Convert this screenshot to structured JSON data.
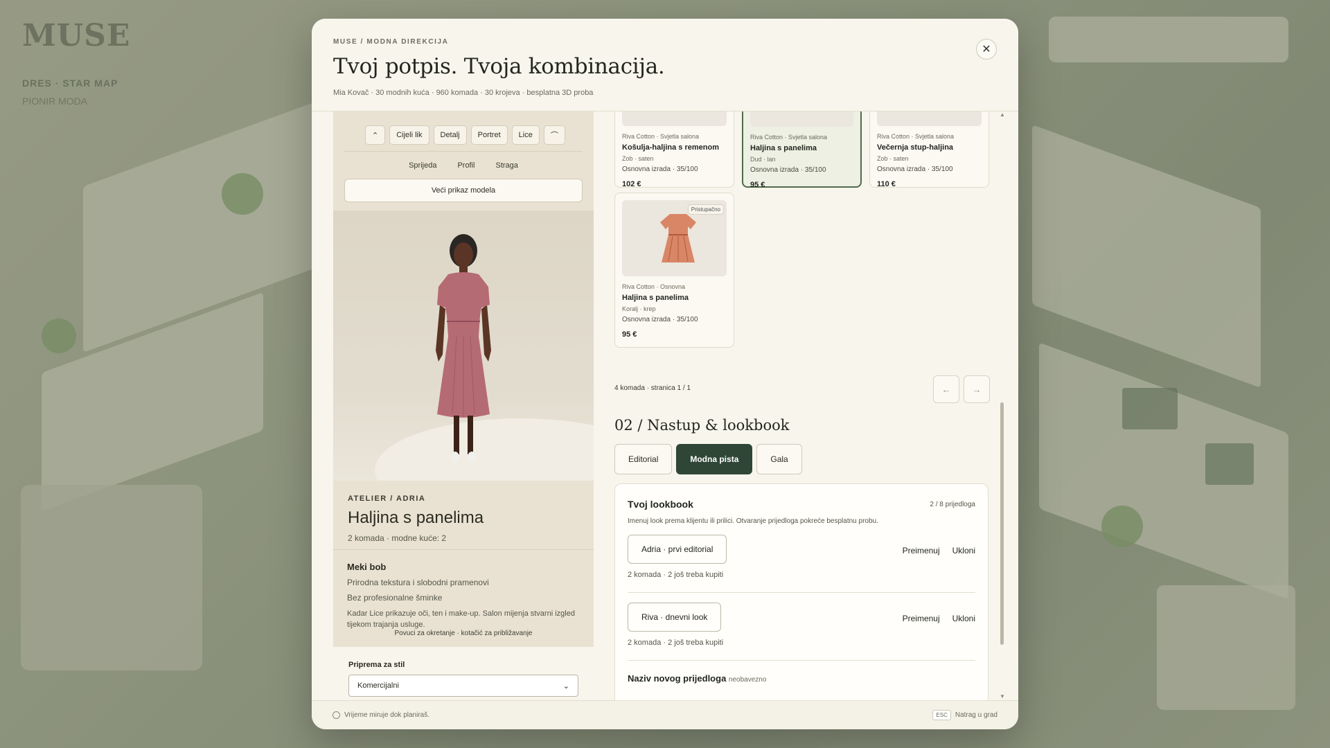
{
  "background": {
    "logo": "MUSE",
    "sub": "DRES · STAR MAP",
    "sub2": "PIONIR MODA"
  },
  "modal": {
    "breadcrumb": "MUSE / MODNA DIREKCIJA",
    "title": "Tvoj potpis. Tvoja kombinacija.",
    "meta": "Mia Kovač · 30 modnih kuća · 960 komada · 30 krojeva · besplatna 3D proba",
    "close_icon": "close-icon"
  },
  "viewer": {
    "views": [
      "Cijeli lik",
      "Detalj",
      "Portret",
      "Lice"
    ],
    "angles": [
      "Sprijeda",
      "Profil",
      "Straga"
    ],
    "big_button": "Veći prikaz modela",
    "atelier": "ATELIER / ADRIA",
    "dress_title": "Haljina s panelima",
    "dress_meta": "2 komada · modne kuće: 2",
    "hair_title": "Meki bob",
    "hair_line1": "Prirodna tekstura i slobodni pramenovi",
    "hair_line2": "Bez profesionalne šminke",
    "hair_note": "Kadar Lice prikazuje oči, ten i make-up. Salon mijenja stvarni izgled tijekom trajanja usluge.",
    "hint": "Povuci za okretanje · kotačić za približavanje",
    "prep_label": "Priprema za stil",
    "prep_value": "Komercijalni",
    "dress_color": "#b56b74"
  },
  "catalog": {
    "items": [
      {
        "brand": "Riva Cotton · Svjetla salona",
        "name": "Košulja-haljina s remenom",
        "material": "Zob · saten",
        "grade": "Osnovna izrada · 35/100",
        "price": "102 €"
      },
      {
        "brand": "Riva Cotton · Svjetla salona",
        "name": "Haljina s panelima",
        "material": "Dud · lan",
        "grade": "Osnovna izrada · 35/100",
        "price": "95 €"
      },
      {
        "brand": "Riva Cotton · Svjetla salona",
        "name": "Večernja stup-haljina",
        "material": "Zob · saten",
        "grade": "Osnovna izrada · 35/100",
        "price": "110 €"
      },
      {
        "brand": "Riva Cotton · Osnovna",
        "name": "Haljina s panelima",
        "material": "Koralj · krep",
        "grade": "Osnovna izrada · 35/100",
        "price": "95 €",
        "badge": "Pristupačno",
        "color": "#d98666"
      }
    ],
    "pager": "4 komada · stranica 1 / 1",
    "prev": "←",
    "next": "→"
  },
  "show": {
    "title": "02 / Nastup & lookbook",
    "tabs": [
      "Editorial",
      "Modna pista",
      "Gala"
    ],
    "lookbook_title": "Tvoj lookbook",
    "lookbook_count": "2 / 8 prijedloga",
    "lookbook_sub": "Imenuj look prema klijentu ili prilici. Otvaranje prijedloga pokreće besplatnu probu.",
    "looks": [
      {
        "name": "Adria · prvi editorial",
        "status": "2 komada · 2 još treba kupiti"
      },
      {
        "name": "Riva · dnevni look",
        "status": "2 komada · 2 još treba kupiti"
      }
    ],
    "rename": "Preimenuj",
    "remove": "Ukloni",
    "new_label": "Naziv novog prijedloga",
    "new_optional": "neobavezno"
  },
  "footer": {
    "left": "Vrijeme miruje dok planiraš.",
    "key": "ESC",
    "right": "Natrag u grad"
  }
}
